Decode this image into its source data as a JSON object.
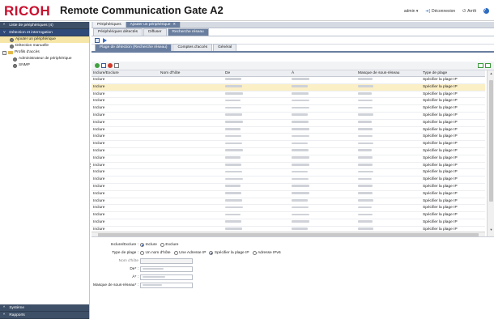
{
  "header": {
    "logo": "RICOH",
    "title": "Remote Communication Gate A2",
    "user": "admin ▾",
    "logout": "Déconnexion",
    "shutdown": "Arrêt",
    "help": "?"
  },
  "sidebar": {
    "sections": [
      {
        "label": "Liste de périphériques (4)",
        "expanded": false
      },
      {
        "label": "Détection et interrogation",
        "expanded": true
      }
    ],
    "items": [
      {
        "label": "Ajouter un périphérique",
        "selected": true
      },
      {
        "label": "Détection manuelle",
        "selected": false
      }
    ],
    "tree": {
      "root": "Profils d'accès",
      "children": [
        "Administrateur de périphérique",
        "SNMP"
      ]
    },
    "bottom_sections": [
      "Système",
      "Rapports"
    ]
  },
  "tabs_top": [
    {
      "label": "Périphériques",
      "active": false
    },
    {
      "label": "Ajouter un périphérique",
      "active": true,
      "closable": true
    }
  ],
  "tabs_second": [
    {
      "label": "Périphériques détectés",
      "active": false
    },
    {
      "label": "Diffuser",
      "active": false
    },
    {
      "label": "Recherche réseau",
      "active": true
    }
  ],
  "tabs_third": [
    {
      "label": "Plage de détection (Recherche réseau)",
      "active": true
    },
    {
      "label": "Comptes d'accès",
      "active": false
    },
    {
      "label": "Général",
      "active": false
    }
  ],
  "table": {
    "columns": [
      "Inclure/Exclure",
      "Nom d'hôte",
      "De",
      "À",
      "Masque de sous-réseau",
      "Type de plage"
    ],
    "rows": [
      {
        "include": "Inclure",
        "type": "Spécifier la plage IP",
        "selected": false
      },
      {
        "include": "Inclure",
        "type": "Spécifier la plage IP",
        "selected": true
      },
      {
        "include": "Inclure",
        "type": "Spécifier la plage IP",
        "selected": false
      },
      {
        "include": "Inclure",
        "type": "Spécifier la plage IP",
        "selected": false
      },
      {
        "include": "Inclure",
        "type": "Spécifier la plage IP",
        "selected": false
      },
      {
        "include": "Inclure",
        "type": "Spécifier la plage IP",
        "selected": false
      },
      {
        "include": "Inclure",
        "type": "Spécifier la plage IP",
        "selected": false
      },
      {
        "include": "Inclure",
        "type": "Spécifier la plage IP",
        "selected": false
      },
      {
        "include": "Inclure",
        "type": "Spécifier la plage IP",
        "selected": false
      },
      {
        "include": "Inclure",
        "type": "Spécifier la plage IP",
        "selected": false
      },
      {
        "include": "Inclure",
        "type": "Spécifier la plage IP",
        "selected": false
      },
      {
        "include": "Inclure",
        "type": "Spécifier la plage IP",
        "selected": false
      },
      {
        "include": "Inclure",
        "type": "Spécifier la plage IP",
        "selected": false
      },
      {
        "include": "Inclure",
        "type": "Spécifier la plage IP",
        "selected": false
      },
      {
        "include": "Inclure",
        "type": "Spécifier la plage IP",
        "selected": false
      },
      {
        "include": "Inclure",
        "type": "Spécifier la plage IP",
        "selected": false
      },
      {
        "include": "Inclure",
        "type": "Spécifier la plage IP",
        "selected": false
      },
      {
        "include": "Inclure",
        "type": "Spécifier la plage IP",
        "selected": false
      },
      {
        "include": "Inclure",
        "type": "Spécifier la plage IP",
        "selected": false
      },
      {
        "include": "Inclure",
        "type": "Spécifier la plage IP",
        "selected": false
      },
      {
        "include": "Inclure",
        "type": "Spécifier la plage IP",
        "selected": false
      },
      {
        "include": "Inclure",
        "type": "Spécifier la plage IP",
        "selected": false
      },
      {
        "include": "Inclure",
        "type": "Spécifier la plage IP",
        "selected": false
      },
      {
        "include": "Inclure",
        "type": "Spécifier la plage IP",
        "selected": false
      },
      {
        "include": "Inclure",
        "type": "Spécifier la plage IP",
        "selected": false
      }
    ]
  },
  "form": {
    "include_exclude_label": "Inclure/Exclure :",
    "include_option": "Inclure",
    "exclude_option": "Exclure",
    "include_selected": true,
    "range_type_label": "Type de plage :",
    "range_options": [
      {
        "label": "Un nom d'hôte",
        "checked": false
      },
      {
        "label": "Une Adresse IP",
        "checked": false
      },
      {
        "label": "Spécifier la plage IP",
        "checked": true
      },
      {
        "label": "Adresse IPv6",
        "checked": false
      }
    ],
    "hostname_label": "Nom d'hôte",
    "from_label": "De* :",
    "to_label": "À* :",
    "subnet_label": "Masque de sous-réseau* :"
  },
  "colors": {
    "brand": "#c8102e",
    "sidebar_header": "#3e4f68",
    "active_tab": "#6a7fa0",
    "selected_row": "#fbefc6"
  }
}
